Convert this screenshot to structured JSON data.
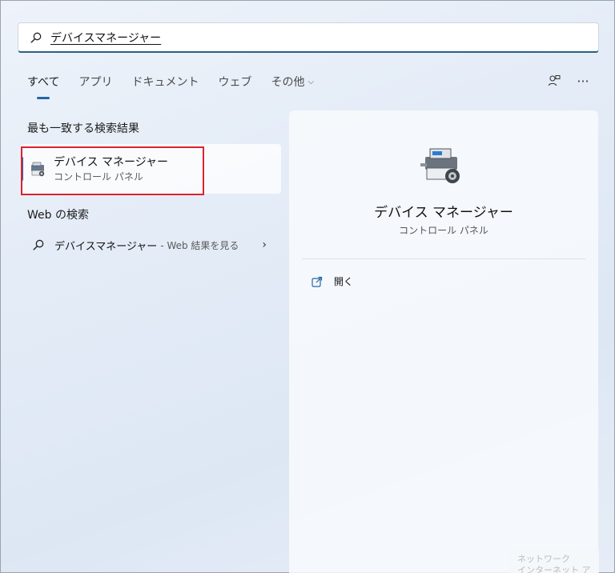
{
  "search": {
    "query": "デバイスマネージャー",
    "icon": "search-icon"
  },
  "tabs": [
    {
      "label": "すべて",
      "active": true
    },
    {
      "label": "アプリ"
    },
    {
      "label": "ドキュメント"
    },
    {
      "label": "ウェブ"
    },
    {
      "label": "その他"
    }
  ],
  "top_right": {
    "share_icon": "people-icon",
    "more_label": "···"
  },
  "best_match": {
    "section_title": "最も一致する検索結果",
    "name": "デバイス マネージャー",
    "subtitle": "コントロール パネル",
    "icon": "device-manager-icon",
    "highlight_color": "#d9232e"
  },
  "web_search": {
    "section_title": "Web の検索",
    "query": "デバイスマネージャー",
    "suffix": "- Web 結果を見る",
    "arrow": "›"
  },
  "detail": {
    "title": "デバイス マネージャー",
    "subtitle": "コントロール パネル",
    "actions": [
      {
        "label": "開く",
        "icon": "open-external-icon"
      }
    ]
  },
  "watermark": {
    "line1": "ネットワーク",
    "line2": "インターネット アクセス"
  },
  "colors": {
    "accent": "#2366a8",
    "selection_bar": "#3a5ea8"
  }
}
